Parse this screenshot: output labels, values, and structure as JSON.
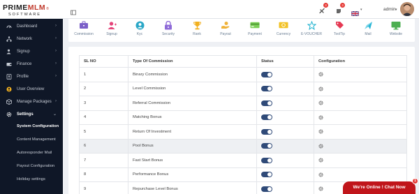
{
  "brand": {
    "name_part1": "PRIME",
    "name_part2": "MLM",
    "sub": "SOFTWARE",
    "reg": "®"
  },
  "header": {
    "notifications_count": "3",
    "messages_count": "3",
    "user_label": "admin",
    "menu_icon": "hamburger-icon"
  },
  "sidebar": {
    "items": [
      {
        "label": "Dashboard",
        "icon": "dashboard-icon",
        "has_chevron": true
      },
      {
        "label": "Network",
        "icon": "network-icon",
        "has_chevron": true
      },
      {
        "label": "Signup",
        "icon": "signup-icon",
        "has_chevron": true
      },
      {
        "label": "Finance",
        "icon": "finance-icon",
        "has_chevron": true
      },
      {
        "label": "Profile",
        "icon": "profile-icon",
        "has_chevron": true
      },
      {
        "label": "User Overview",
        "icon": "user-overview-icon",
        "has_chevron": false
      },
      {
        "label": "Manage Packages",
        "icon": "packages-icon",
        "has_chevron": true
      },
      {
        "label": "Settings",
        "icon": "settings-icon",
        "has_chevron": true
      }
    ],
    "settings_sub": [
      {
        "label": "System Configuration"
      },
      {
        "label": "Content Management"
      },
      {
        "label": "Autoresponder Mail"
      },
      {
        "label": "Payout Configuration"
      },
      {
        "label": "Holiday settings"
      }
    ]
  },
  "tabs": [
    {
      "label": "Commission",
      "icon": "briefcase-icon",
      "color": "#7a5ec8"
    },
    {
      "label": "Signup",
      "icon": "signup-user-icon",
      "color": "#e5457a"
    },
    {
      "label": "Kyc",
      "icon": "kyc-icon",
      "color": "#2aa7c7"
    },
    {
      "label": "Security",
      "icon": "lock-icon",
      "color": "#8e6ad8"
    },
    {
      "label": "Rank",
      "icon": "trophy-icon",
      "color": "#f2b01e"
    },
    {
      "label": "Payout",
      "icon": "payout-icon",
      "color": "#f0b33a"
    },
    {
      "label": "Payment",
      "icon": "payment-icon",
      "color": "#7ccf57"
    },
    {
      "label": "Currency",
      "icon": "currency-icon",
      "color": "#f2c227"
    },
    {
      "label": "E-VOUCHER",
      "icon": "voucher-icon",
      "color": "#1fb2cf"
    },
    {
      "label": "ToolTip",
      "icon": "tooltip-icon",
      "color": "#e53953"
    },
    {
      "label": "Mail",
      "icon": "mail-icon",
      "color": "#2ab6d6"
    },
    {
      "label": "Website",
      "icon": "website-icon",
      "color": "#4caf50"
    }
  ],
  "table": {
    "headers": {
      "sl": "SL NO",
      "type": "Type Of Commission",
      "status": "Status",
      "config": "Configuration"
    },
    "rows": [
      {
        "sl": "1",
        "type": "Binary Commission"
      },
      {
        "sl": "2",
        "type": "Level Commission"
      },
      {
        "sl": "3",
        "type": "Referral Commission"
      },
      {
        "sl": "4",
        "type": "Matching Bonus"
      },
      {
        "sl": "5",
        "type": "Return Of Investment"
      },
      {
        "sl": "6",
        "type": "Pool Bonus"
      },
      {
        "sl": "7",
        "type": "Fast Start Bonus"
      },
      {
        "sl": "8",
        "type": "Performance Bonus"
      },
      {
        "sl": "9",
        "type": "Repurchase Level Bonus"
      }
    ]
  },
  "chat": {
    "label": "We're Online ! Chat Now",
    "badge": "1"
  },
  "colors": {
    "sidebar_bg": "#0f1727",
    "toggle_on": "#2f4a78",
    "chat_bg": "#c0151a",
    "badge": "#e53935"
  }
}
